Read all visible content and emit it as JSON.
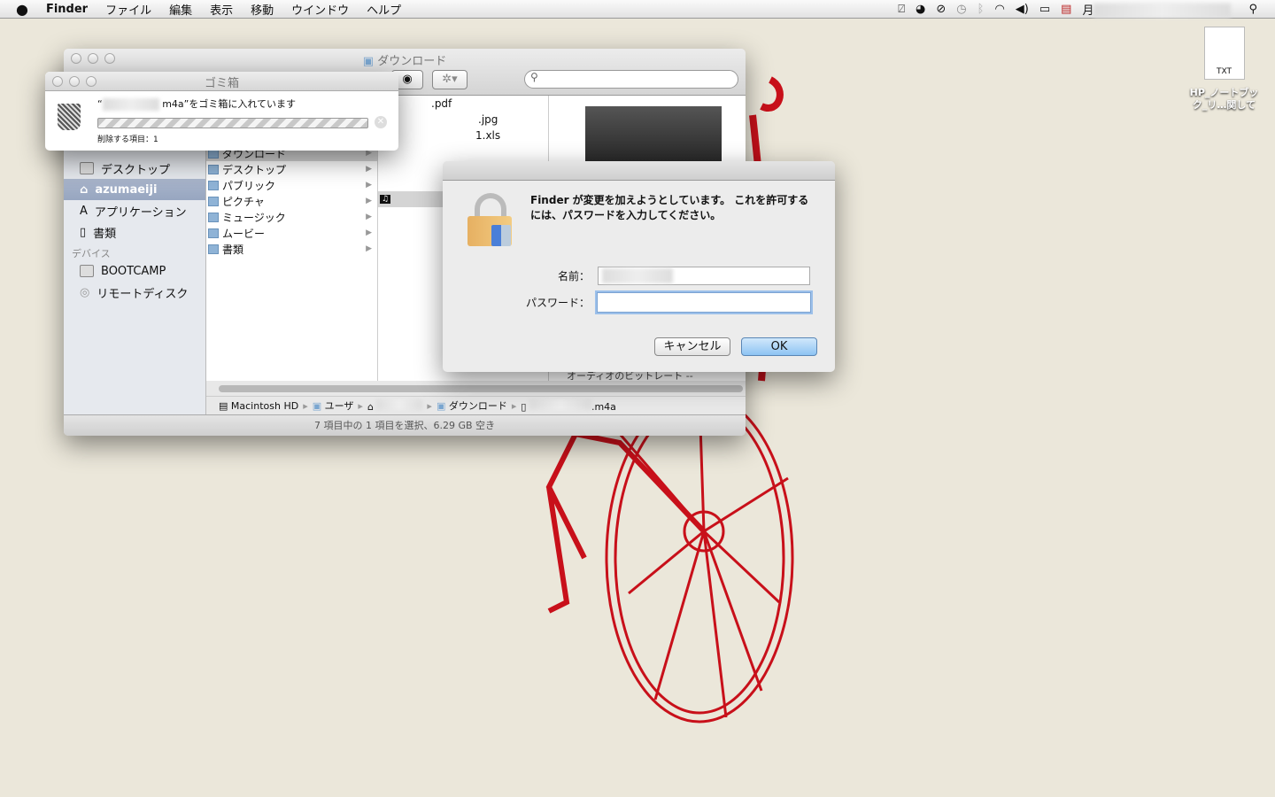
{
  "menubar": {
    "app": "Finder",
    "items": [
      "ファイル",
      "編集",
      "表示",
      "移動",
      "ウインドウ",
      "ヘルプ"
    ],
    "clock_prefix": "月"
  },
  "desktop": {
    "file_icon_type": "TXT",
    "file_label_line1": "HP_ノートブッ",
    "file_label_line2": "ク_リ…関して"
  },
  "finder": {
    "title": "ダウンロード",
    "search_placeholder": "",
    "sidebar": {
      "items": [
        "デスクトップ",
        "azumaeiji",
        "アプリケーション",
        "書類"
      ],
      "devices_header": "デバイス",
      "devices": [
        "BOOTCAMP",
        "リモートディスク"
      ]
    },
    "column1": [
      "ダウンロード",
      "デスクトップ",
      "パブリック",
      "ピクチャ",
      "ミュージック",
      "ムービー",
      "書類"
    ],
    "column2": [
      ".pdf",
      ".jpg",
      "1.xls"
    ],
    "preview_caption": "オーディオのビットレート --",
    "path": [
      "Macintosh HD",
      "ユーザ",
      "",
      "ダウンロード",
      ".m4a"
    ],
    "status": "7 項目中の 1 項目を選択、6.29 GB 空き"
  },
  "trash": {
    "title": "ゴミ箱",
    "message_open": "“",
    "message_rest": "m4a”をゴミ箱に入れています",
    "items_label": "削除する項目：1"
  },
  "auth": {
    "message": "Finder が変更を加えようとしています。 これを許可するには、パスワードを入力してください。",
    "name_label": "名前：",
    "password_label": "パスワード：",
    "name_value": "",
    "password_value": "",
    "cancel": "キャンセル",
    "ok": "OK"
  }
}
